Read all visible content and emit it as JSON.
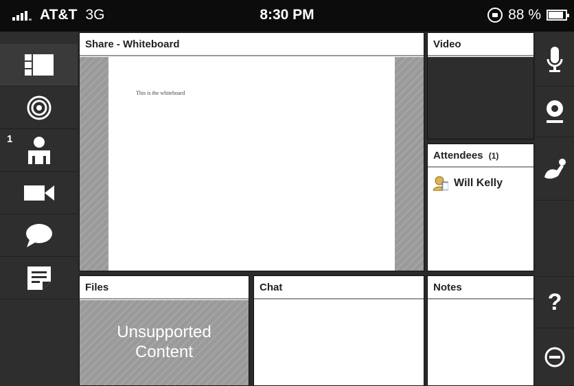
{
  "status_bar": {
    "carrier": "AT&T",
    "network": "3G",
    "time": "8:30 PM",
    "battery": "88 %",
    "battery_level": 0.88
  },
  "left_nav": {
    "items": [
      {
        "icon": "layout-icon"
      },
      {
        "icon": "target-icon"
      },
      {
        "icon": "attendee-icon",
        "badge": "1"
      },
      {
        "icon": "video-camera-icon"
      },
      {
        "icon": "chat-bubble-icon"
      },
      {
        "icon": "notes-icon"
      }
    ]
  },
  "right_nav": {
    "items": [
      {
        "icon": "microphone-icon"
      },
      {
        "icon": "webcam-icon"
      },
      {
        "icon": "raise-hand-icon"
      },
      {
        "icon": "help-icon",
        "label": "?"
      },
      {
        "icon": "leave-icon"
      }
    ]
  },
  "panels": {
    "share": {
      "title": "Share - Whiteboard",
      "whiteboard_text": "This is the whiteboard"
    },
    "video": {
      "title": "Video"
    },
    "attendees": {
      "title": "Attendees",
      "count": "(1)",
      "list": [
        {
          "name": "Will Kelly"
        }
      ]
    },
    "files": {
      "title": "Files",
      "message_line1": "Unsupported",
      "message_line2": "Content"
    },
    "chat": {
      "title": "Chat"
    },
    "notes": {
      "title": "Notes"
    }
  },
  "colors": {
    "status_bar_bg": "#0c0c0c",
    "sidebar_bg": "#2e2e2e",
    "panel_bg": "#ffffff",
    "hatched_bg": "#9a9a9a",
    "video_bg": "#2d2d2d"
  }
}
